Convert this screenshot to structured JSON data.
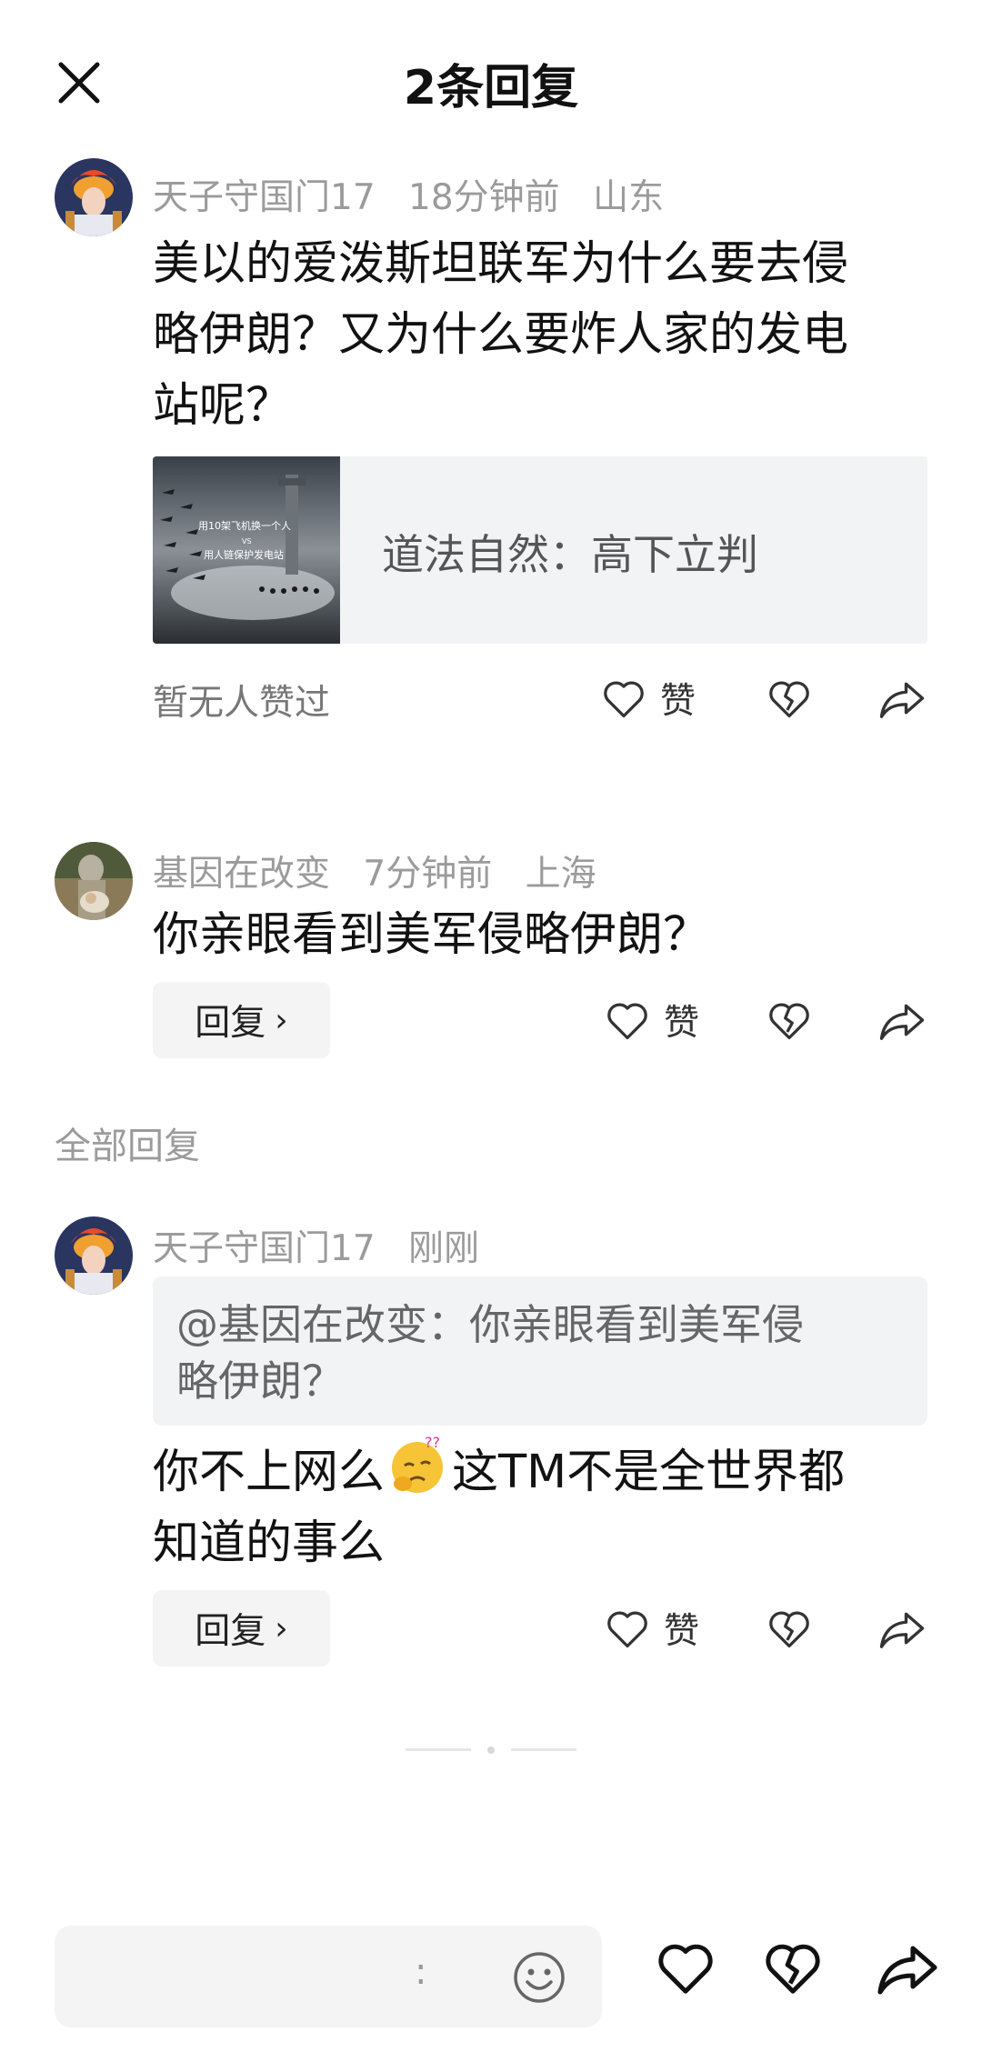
{
  "header": {
    "title": "2条回复"
  },
  "main_comment": {
    "username": "天子守国门17",
    "time": "18分钟前",
    "location": "山东",
    "text_line1": "美以的爱泼斯坦联军为什么要去侵",
    "text_line2": "略伊朗？又为什么要炸人家的发电",
    "text_line3": "站呢？",
    "link_card": {
      "thumb_line1": "用10架飞机换一个人",
      "thumb_vs": "VS",
      "thumb_line2": "用人链保护发电站",
      "title": "道法自然：高下立判"
    },
    "no_likes": "暂无人赞过",
    "like_label": "赞"
  },
  "reply1": {
    "username": "基因在改变",
    "time": "7分钟前",
    "location": "上海",
    "text": "你亲眼看到美军侵略伊朗？",
    "reply_label": "回复",
    "like_label": "赞"
  },
  "section": {
    "title": "全部回复"
  },
  "reply2": {
    "username": "天子守国门17",
    "time": "刚刚",
    "quote_line1": "@基因在改变：你亲眼看到美军侵",
    "quote_line2": "略伊朗？",
    "text_part1": "你不上网么",
    "text_part2": "这TM不是全世界都",
    "text_line2": "知道的事么",
    "reply_label": "回复",
    "like_label": "赞"
  },
  "input": {
    "placeholder_colon": ":"
  },
  "icons": {
    "close": "close-icon",
    "like": "heart-icon",
    "dislike": "broken-heart-icon",
    "share": "share-arrow-icon",
    "emoji": "smiley-icon",
    "confused_emoji": "confused-face-emoji"
  },
  "colors": {
    "meta_gray": "#9b9b9b",
    "card_bg": "#f2f3f5",
    "text": "#121212"
  }
}
